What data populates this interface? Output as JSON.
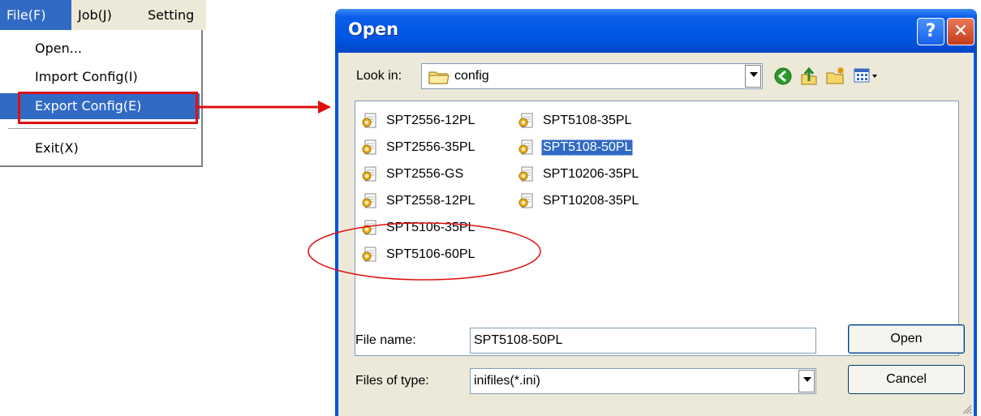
{
  "menubar": {
    "items": [
      {
        "label": "File(F)"
      },
      {
        "label": "Job(J)"
      },
      {
        "label": "Setting"
      }
    ]
  },
  "file_menu": {
    "items": [
      {
        "label": "Open..."
      },
      {
        "label": "Import Config(I)"
      },
      {
        "label": "Export Config(E)"
      },
      {
        "label": "Exit(X)"
      }
    ]
  },
  "dialog": {
    "title": "Open",
    "help_glyph": "?",
    "close_glyph": "✕",
    "look_in": {
      "label": "Look in:",
      "value": "config"
    },
    "toolbar": {
      "icons": [
        "back-icon",
        "up-folder-icon",
        "new-folder-icon",
        "view-menu-icon"
      ]
    },
    "files": {
      "column1": [
        "SPT2556-12PL",
        "SPT2556-35PL",
        "SPT2556-GS",
        "SPT2558-12PL",
        "SPT5106-35PL",
        "SPT5106-60PL"
      ],
      "column2": [
        "SPT5108-35PL",
        "SPT5108-50PL",
        "SPT10206-35PL",
        "SPT10208-35PL"
      ],
      "selected": "SPT5108-50PL"
    },
    "file_name": {
      "label": "File name:",
      "value": "SPT5108-50PL"
    },
    "file_type": {
      "label": "Files of type:",
      "value": "inifiles(*.ini)"
    },
    "buttons": {
      "open": "Open",
      "cancel": "Cancel"
    }
  },
  "colors": {
    "annotation": "#e01010",
    "selection": "#316ac5",
    "titlebar": "#0058e6",
    "dialog_face": "#ece9d8"
  }
}
